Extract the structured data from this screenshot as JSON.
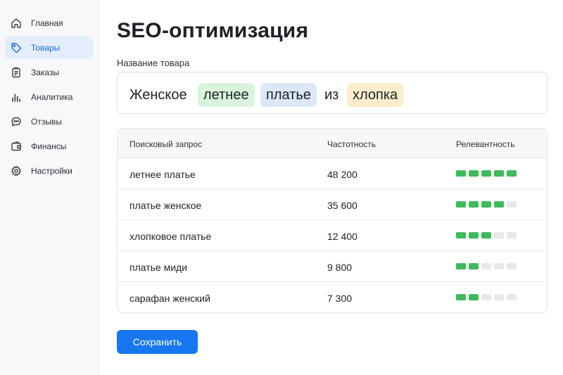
{
  "sidebar": {
    "items": [
      {
        "label": "Главная",
        "icon": "home-icon",
        "active": false
      },
      {
        "label": "Товары",
        "icon": "tag-icon",
        "active": true
      },
      {
        "label": "Заказы",
        "icon": "clipboard-icon",
        "active": false
      },
      {
        "label": "Аналитика",
        "icon": "bar-chart-icon",
        "active": false
      },
      {
        "label": "Отзывы",
        "icon": "chat-icon",
        "active": false
      },
      {
        "label": "Финансы",
        "icon": "wallet-icon",
        "active": false
      },
      {
        "label": "Настройки",
        "icon": "gear-icon",
        "active": false
      }
    ]
  },
  "main": {
    "title": "SEO-оптимизация",
    "field_label": "Название товара",
    "product_words": [
      {
        "text": "Женское",
        "highlight": "none"
      },
      {
        "text": "летнее",
        "highlight": "green"
      },
      {
        "text": "платье",
        "highlight": "blue"
      },
      {
        "text": "из",
        "highlight": "none"
      },
      {
        "text": "хлопка",
        "highlight": "yellow"
      }
    ],
    "table": {
      "headers": [
        "Поисковый запрос",
        "Частотность",
        "Релевантность"
      ],
      "rows": [
        {
          "query": "летнее платье",
          "frequency": "48 200",
          "relevance": 5
        },
        {
          "query": "платье женское",
          "frequency": "35 600",
          "relevance": 4
        },
        {
          "query": "хлопковое платье",
          "frequency": "12 400",
          "relevance": 3
        },
        {
          "query": "платье миди",
          "frequency": "9 800",
          "relevance": 2
        },
        {
          "query": "сарафан женский",
          "frequency": "7 300",
          "relevance": 2
        }
      ],
      "relevance_max": 5
    },
    "save_label": "Сохранить"
  },
  "colors": {
    "accent": "#1677f0",
    "relevance_on": "#3dba5a",
    "relevance_off": "#e6e8eb",
    "chip_green": "#d9f3dc",
    "chip_blue": "#dce8f7",
    "chip_yellow": "#fbeccc"
  }
}
